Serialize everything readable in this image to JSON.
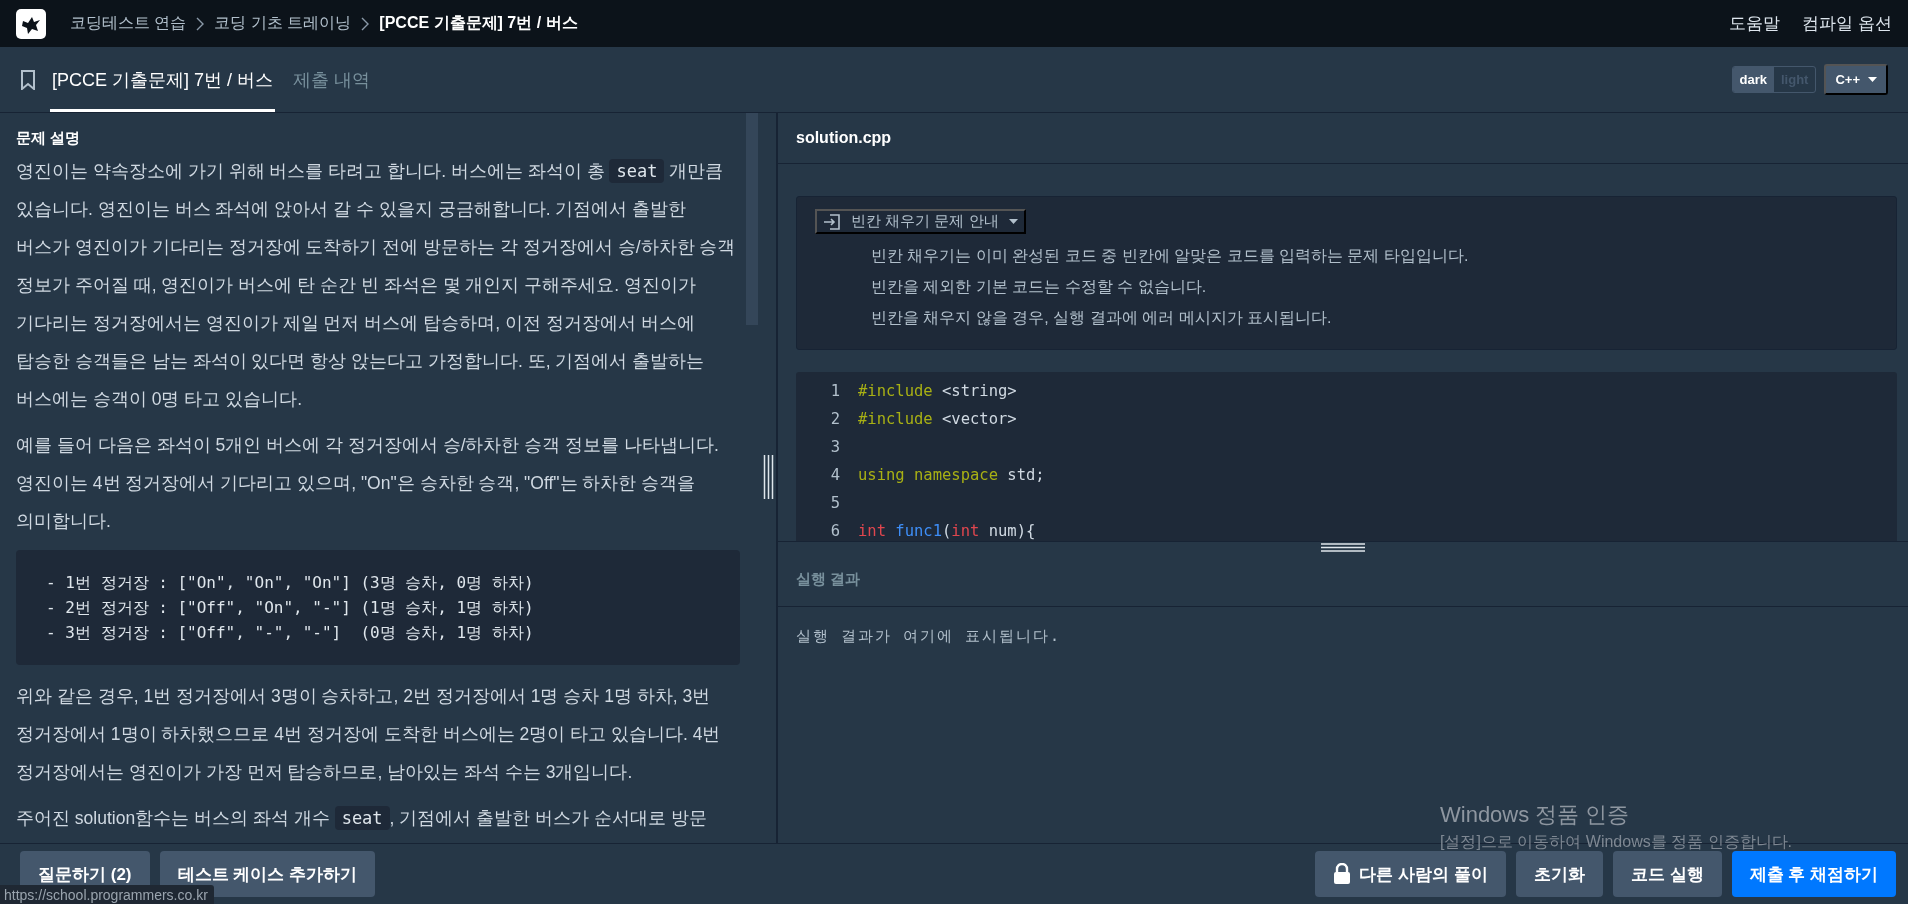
{
  "breadcrumb": [
    "코딩테스트 연습",
    "코딩 기초 트레이닝",
    "[PCCE 기출문제] 7번 / 버스"
  ],
  "nav_links": [
    "도움말",
    "컴파일 옵션"
  ],
  "tabs": [
    {
      "label": "[PCCE 기출문제] 7번 / 버스",
      "selected": true
    },
    {
      "label": "제출 내역",
      "selected": false
    }
  ],
  "theme_toggle": [
    {
      "label": "dark",
      "selected": true
    },
    {
      "label": "light",
      "selected": false
    }
  ],
  "language": "C++",
  "problem": {
    "heading": "문제 설명",
    "blocks": [
      {
        "kind": "paragraph",
        "parts": [
          {
            "kind": "text",
            "text": "영진이는 약속장소에 가기 위해 버스를 타려고 합니다. 버스에는 좌석이 총 "
          },
          {
            "kind": "code",
            "text": "seat"
          },
          {
            "kind": "text",
            "text": " 개만큼 있습니다. 영진이는 버스 좌석에 앉아서 갈 수 있을지 궁금해합니다. 기점에서 출발한 버스가 영진이가 기다리는 정거장에 도착하기 전에 방문하는 각 정거장에서 승/하차한 승객 정보가 주어질 때, 영진이가 버스에 탄 순간 빈 좌석은 몇 개인지 구해주세요. 영진이가 기다리는 정거장에서는 영진이가 제일 먼저 버스에 탑승하며, 이전 정거장에서 버스에 탑승한 승객들은 남는 좌석이 있다면 항상 앉는다고 가정합니다. 또, 기점에서 출발하는 버스에는 승객이 0명 타고 있습니다."
          }
        ]
      },
      {
        "kind": "paragraph",
        "parts": [
          {
            "kind": "text",
            "text": "예를 들어 다음은 좌석이 5개인 버스에 각 정거장에서 승/하차한 승객 정보를 나타냅니다. 영진이는 4번 정거장에서 기다리고 있으며, \"On\"은 승차한 승객, \"Off\"는 하차한 승객을 의미합니다."
          }
        ]
      },
      {
        "kind": "code",
        "lines": [
          "- 1번 정거장 : [\"On\", \"On\", \"On\"] (3명 승차, 0명 하차)",
          "- 2번 정거장 : [\"Off\", \"On\", \"-\"] (1명 승차, 1명 하차)",
          "- 3번 정거장 : [\"Off\", \"-\", \"-\"]  (0명 승차, 1명 하차)"
        ]
      },
      {
        "kind": "paragraph",
        "parts": [
          {
            "kind": "text",
            "text": "위와 같은 경우, 1번 정거장에서 3명이 승차하고, 2번 정거장에서 1명 승차 1명 하차, 3번 정거장에서 1명이 하차했으므로 4번 정거장에 도착한 버스에는 2명이 타고 있습니다. 4번 정거장에서는 영진이가 가장 먼저 탑승하므로, 남아있는 좌석 수는 3개입니다."
          }
        ]
      },
      {
        "kind": "paragraph",
        "parts": [
          {
            "kind": "text",
            "text": "주어진 solution함수는 버스의 좌석 개수 "
          },
          {
            "kind": "code",
            "text": "seat"
          },
          {
            "kind": "text",
            "text": ", 기점에서 출발한 버스가 순서대로 방문"
          }
        ]
      }
    ]
  },
  "editor": {
    "filename": "solution.cpp",
    "guide": {
      "title": "빈칸 채우기 문제 안내",
      "expanded": true,
      "lines": [
        "빈칸 채우기는 이미 완성된 코드 중 빈칸에 알맞은 코드를 입력하는 문제 타입입니다.",
        "빈칸을 제외한 기본 코드는 수정할 수 없습니다.",
        "빈칸을 채우지 않을 경우, 실행 결과에 에러 메시지가 표시됩니다."
      ]
    },
    "code": [
      {
        "number": "1",
        "tokens": [
          {
            "kind": "preproc",
            "text": "#include"
          },
          {
            "kind": "plain",
            "text": " <string>"
          }
        ]
      },
      {
        "number": "2",
        "tokens": [
          {
            "kind": "preproc",
            "text": "#include"
          },
          {
            "kind": "plain",
            "text": " <vector>"
          }
        ]
      },
      {
        "number": "3"
      },
      {
        "number": "4",
        "tokens": [
          {
            "kind": "preproc",
            "text": "using namespace"
          },
          {
            "kind": "plain",
            "text": " std;"
          }
        ]
      },
      {
        "number": "5"
      },
      {
        "number": "6",
        "tokens": [
          {
            "kind": "keyword",
            "text": "int "
          },
          {
            "kind": "function",
            "text": "func1"
          },
          {
            "kind": "plain",
            "text": "("
          },
          {
            "kind": "keyword",
            "text": "int"
          },
          {
            "kind": "plain",
            "text": " num){"
          }
        ]
      }
    ]
  },
  "output": {
    "heading": "실행 결과",
    "message": "실행 결과가 여기에 표시됩니다."
  },
  "footer": {
    "left_buttons": [
      "질문하기 (2)",
      "테스트 케이스 추가하기"
    ],
    "right_buttons": [
      {
        "label": "다른 사람의 풀이",
        "kind": "locked"
      },
      {
        "label": "초기화",
        "kind": "default"
      },
      {
        "label": "코드 실행",
        "kind": "default"
      },
      {
        "label": "제출 후 채점하기",
        "kind": "primary"
      }
    ]
  },
  "status_url": "https://school.programmers.co.kr",
  "os_notice": {
    "title": "Windows 정품 인증",
    "subtitle": "[설정]으로 이동하여 Windows를 정품 인증합니다."
  }
}
